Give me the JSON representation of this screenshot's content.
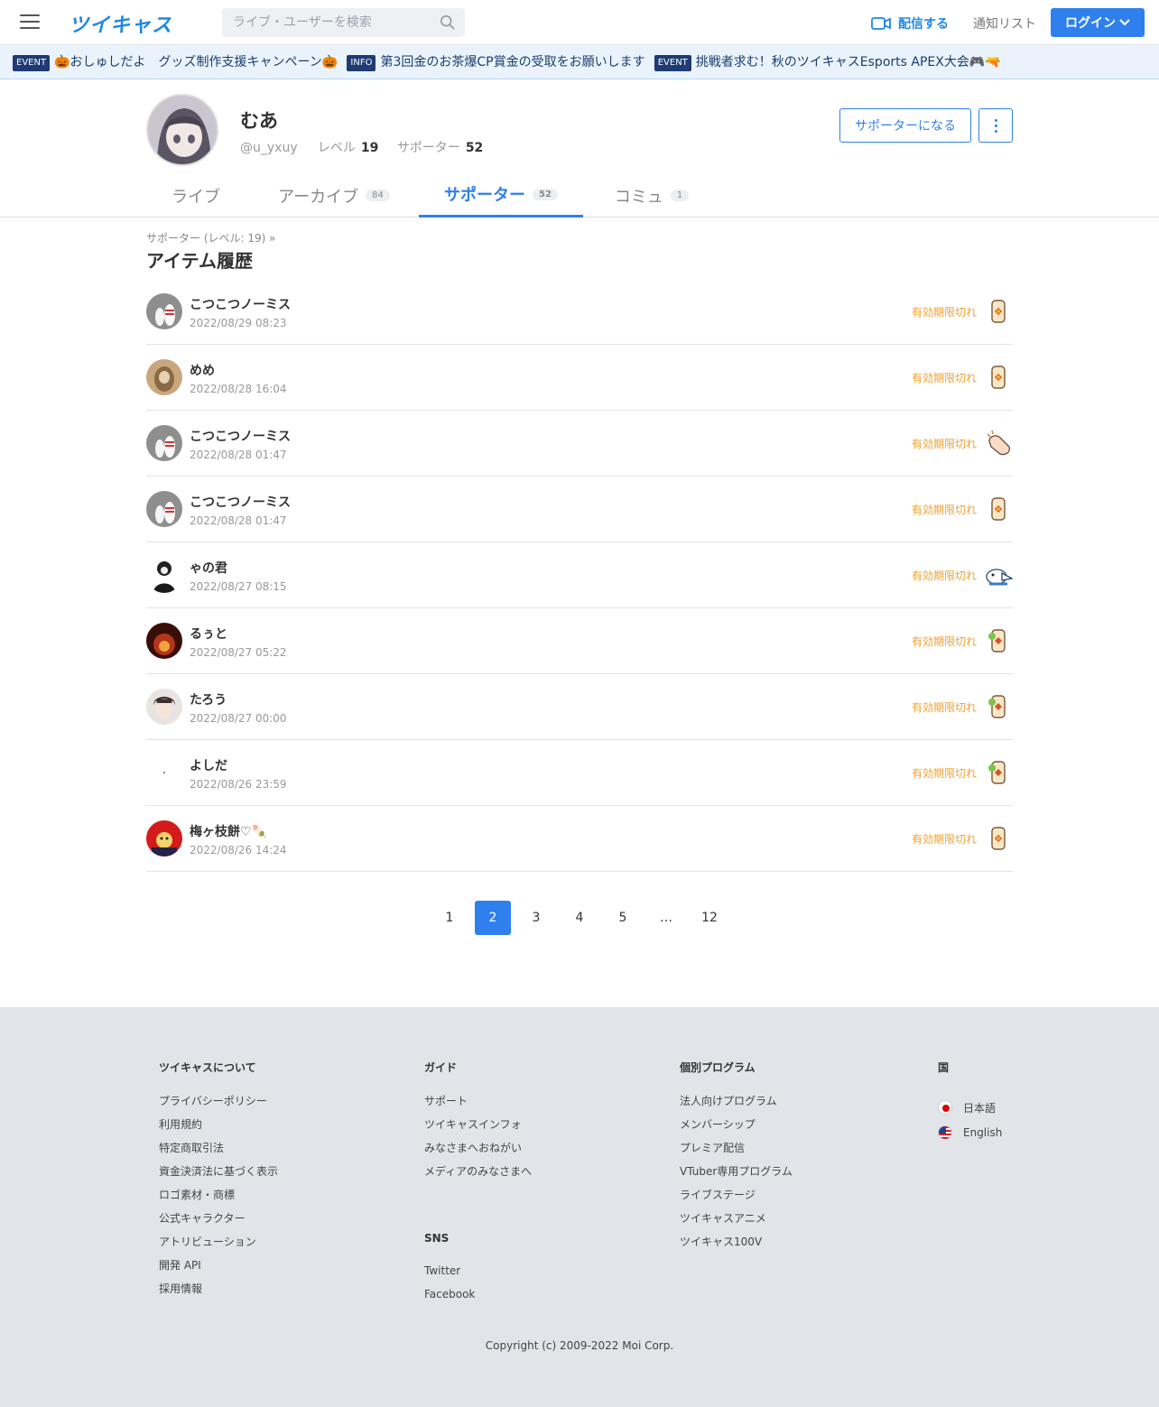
{
  "header": {
    "logo": "ツイキャス",
    "search_placeholder": "ライブ・ユーザーを検索",
    "broadcast_label": "配信する",
    "notify_label": "通知リスト",
    "login_label": "ログイン"
  },
  "ticker": [
    {
      "tag": "EVENT",
      "text": "🎃おしゅしだよ　グッズ制作支援キャンペーン🎃"
    },
    {
      "tag": "INFO",
      "text": "第3回金のお茶爆CP賞金の受取をお願いします"
    },
    {
      "tag": "EVENT",
      "text": "挑戦者求む！秋のツイキャスEsports APEX大会🎮🔫"
    }
  ],
  "profile": {
    "name": "むあ",
    "handle": "@u_yxuy",
    "level_label": "レベル",
    "level": "19",
    "supporter_label": "サポーター",
    "supporter_count": "52",
    "become_supporter": "サポーターになる"
  },
  "tabs": [
    {
      "label": "ライブ",
      "count": ""
    },
    {
      "label": "アーカイブ",
      "count": "84"
    },
    {
      "label": "サポーター",
      "count": "52"
    },
    {
      "label": "コミュ",
      "count": "1"
    }
  ],
  "breadcrumb": "サポーター (レベル: 19)  »",
  "section_title": "アイテム履歴",
  "items": [
    {
      "name": "こつこつノーミス",
      "time": "2022/08/29 08:23",
      "status": "有効期限切れ",
      "avatar": "bowling",
      "item": "tea"
    },
    {
      "name": "めめ",
      "time": "2022/08/28 16:04",
      "status": "有効期限切れ",
      "avatar": "brown",
      "item": "tea"
    },
    {
      "name": "こつこつノーミス",
      "time": "2022/08/28 01:47",
      "status": "有効期限切れ",
      "avatar": "bowling",
      "item": "clap"
    },
    {
      "name": "こつこつノーミス",
      "time": "2022/08/28 01:47",
      "status": "有効期限切れ",
      "avatar": "bowling",
      "item": "tea"
    },
    {
      "name": "ゃの君",
      "time": "2022/08/27 08:15",
      "status": "有効期限切れ",
      "avatar": "dark",
      "item": "bird"
    },
    {
      "name": "るぅと",
      "time": "2022/08/27 05:22",
      "status": "有効期限切れ",
      "avatar": "fire",
      "item": "greentea"
    },
    {
      "name": "たろう",
      "time": "2022/08/27 00:00",
      "status": "有効期限切れ",
      "avatar": "anime",
      "item": "greentea"
    },
    {
      "name": "よしだ",
      "time": "2022/08/26 23:59",
      "status": "有効期限切れ",
      "avatar": "blank",
      "item": "greentea"
    },
    {
      "name": "梅ヶ枝餅♡🍡",
      "time": "2022/08/26 14:24",
      "status": "有効期限切れ",
      "avatar": "red",
      "item": "tea"
    }
  ],
  "pagination": [
    "1",
    "2",
    "3",
    "4",
    "5",
    "…",
    "12"
  ],
  "pagination_active": "2",
  "footer": {
    "col1": {
      "head": "ツイキャスについて",
      "links": [
        "プライバシーポリシー",
        "利用規約",
        "特定商取引法",
        "資金決済法に基づく表示",
        "ロゴ素材・商標",
        "公式キャラクター",
        "アトリビューション",
        "開発 API",
        "採用情報"
      ]
    },
    "col2": {
      "head": "ガイド",
      "links": [
        "サポート",
        "ツイキャスインフォ",
        "みなさまへおねがい",
        "メディアのみなさまへ"
      ]
    },
    "col2b": {
      "head": "SNS",
      "links": [
        "Twitter",
        "Facebook"
      ]
    },
    "col3": {
      "head": "個別プログラム",
      "links": [
        "法人向けプログラム",
        "メンバーシップ",
        "プレミア配信",
        "VTuber専用プログラム",
        "ライブステージ",
        "ツイキャスアニメ",
        "ツイキャス100V"
      ]
    },
    "col4": {
      "head": "国",
      "langs": [
        "日本語",
        "English"
      ]
    },
    "copyright": "Copyright (c) 2009-2022 Moi Corp."
  },
  "colors": {
    "accent": "#2f80ed",
    "expired": "#f0a030",
    "footer_bg": "#e1e4e8"
  }
}
